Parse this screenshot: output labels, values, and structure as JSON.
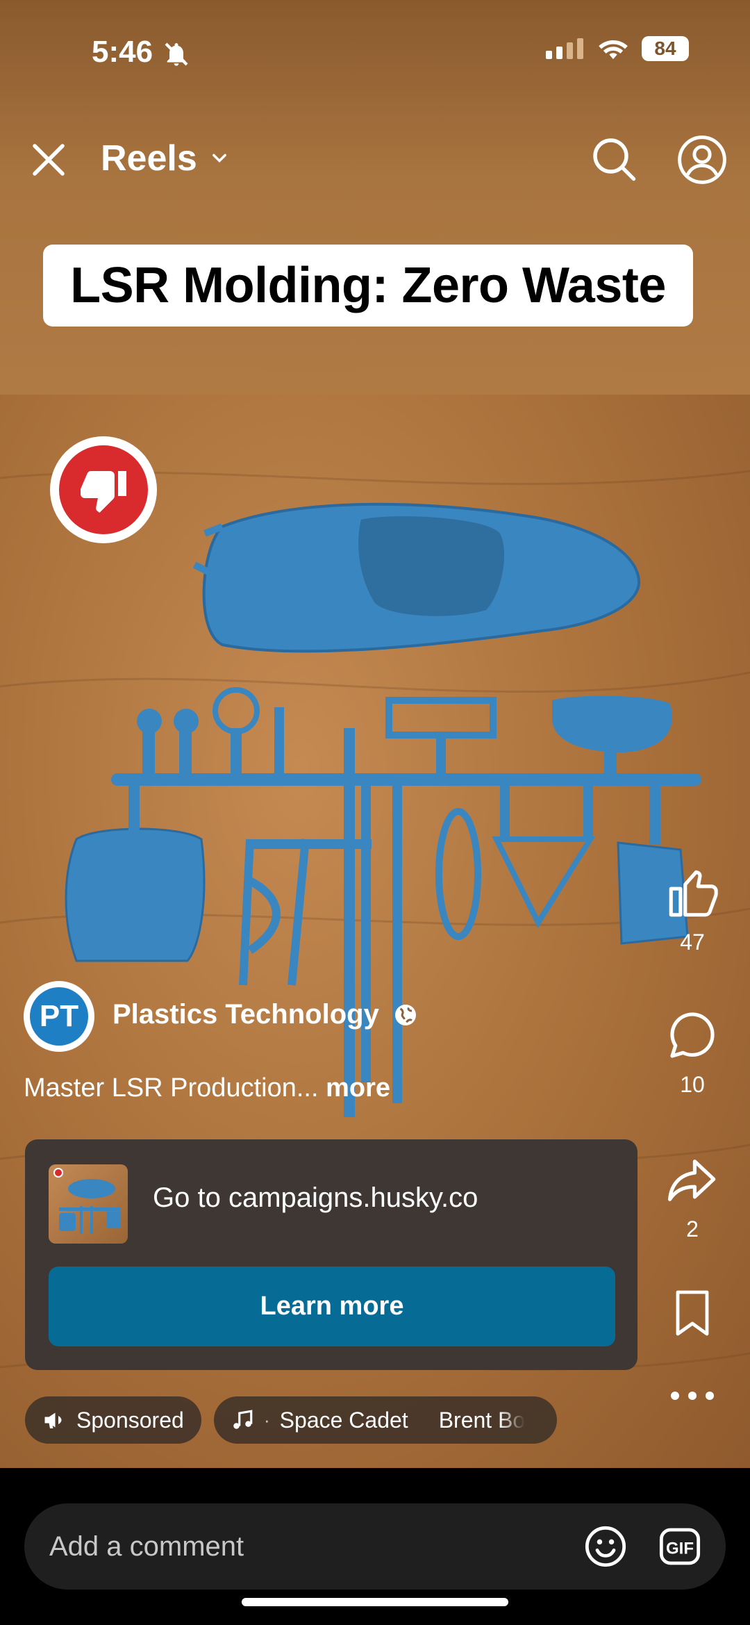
{
  "status": {
    "time": "5:46",
    "battery": "84"
  },
  "header": {
    "title": "Reels"
  },
  "overlay": {
    "title": "LSR Molding: Zero Waste"
  },
  "rail": {
    "likes": "47",
    "comments": "10",
    "shares": "2"
  },
  "author": {
    "initials": "PT",
    "name": "Plastics Technology"
  },
  "caption": {
    "text": "Master LSR Production...",
    "more": "more"
  },
  "ad": {
    "link_text": "Go to campaigns.husky.co",
    "cta": "Learn more"
  },
  "pills": {
    "sponsored": "Sponsored",
    "music_sep": "·",
    "song": "Space Cadet",
    "artist": "Brent Bo"
  },
  "comment": {
    "placeholder": "Add a comment"
  },
  "colors": {
    "accent": "#066b95",
    "dislike": "#d92a2e"
  }
}
